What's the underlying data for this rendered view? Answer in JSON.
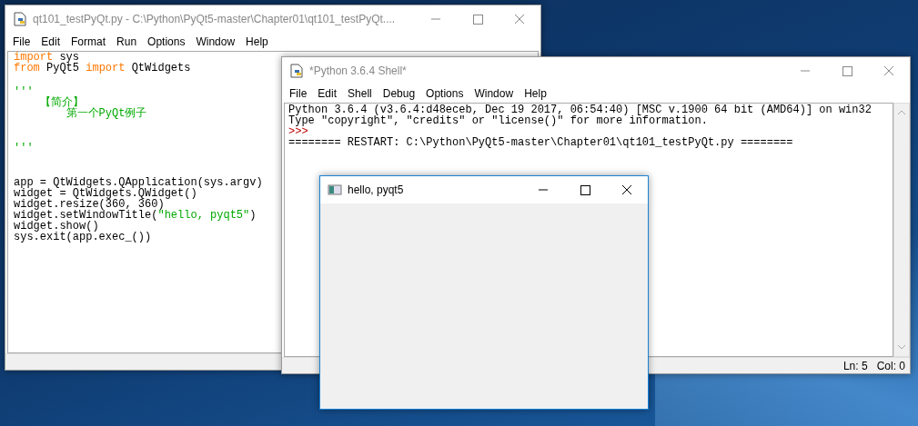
{
  "editor": {
    "title": "qt101_testPyQt.py - C:\\Python\\PyQt5-master\\Chapter01\\qt101_testPyQt....",
    "focused": false,
    "menu": [
      "File",
      "Edit",
      "Format",
      "Run",
      "Options",
      "Window",
      "Help"
    ],
    "code_blocks": [
      [
        [
          {
            "text": "import",
            "kind": "keyword"
          },
          {
            "text": " sys",
            "kind": "plain"
          }
        ],
        [
          {
            "text": "from",
            "kind": "keyword"
          },
          {
            "text": " PyQt5 ",
            "kind": "plain"
          },
          {
            "text": "import",
            "kind": "keyword"
          },
          {
            "text": " QtWidgets",
            "kind": "plain"
          }
        ]
      ],
      [
        [
          {
            "text": "'''",
            "kind": "string"
          }
        ],
        [
          {
            "text": "    【简介】",
            "kind": "string"
          }
        ],
        [
          {
            "text": "        第一个PyQt例子",
            "kind": "string"
          }
        ]
      ],
      [
        [
          {
            "text": "'''",
            "kind": "string"
          }
        ]
      ],
      [
        [
          {
            "text": "app = QtWidgets.QApplication(sys.argv)",
            "kind": "plain"
          }
        ],
        [
          {
            "text": "widget = QtWidgets.QWidget()",
            "kind": "plain"
          }
        ],
        [
          {
            "text": "widget.resize(360, 360)",
            "kind": "plain"
          }
        ],
        [
          {
            "text": "widget.setWindowTitle(",
            "kind": "plain"
          },
          {
            "text": "\"hello, pyqt5\"",
            "kind": "string"
          },
          {
            "text": ")",
            "kind": "plain"
          }
        ],
        [
          {
            "text": "widget.show()",
            "kind": "plain"
          }
        ],
        [
          {
            "text": "sys.exit(app.exec_())",
            "kind": "plain"
          }
        ]
      ]
    ]
  },
  "shell": {
    "title": "*Python 3.6.4 Shell*",
    "focused": false,
    "menu": [
      "File",
      "Edit",
      "Shell",
      "Debug",
      "Options",
      "Window",
      "Help"
    ],
    "lines": [
      {
        "text": "Python 3.6.4 (v3.6.4:d48eceb, Dec 19 2017, 06:54:40) [MSC v.1900 64 bit (AMD64)] on win32",
        "kind": "output"
      },
      {
        "text": "Type \"copyright\", \"credits\" or \"license()\" for more information.",
        "kind": "output"
      },
      {
        "text": ">>>",
        "kind": "prompt"
      },
      {
        "text": "======== RESTART: C:\\Python\\PyQt5-master\\Chapter01\\qt101_testPyQt.py ========",
        "kind": "output"
      }
    ],
    "status": {
      "line": "Ln: 5",
      "column": "Col: 0"
    }
  },
  "app_window": {
    "title": "hello, pyqt5",
    "focused": true
  }
}
